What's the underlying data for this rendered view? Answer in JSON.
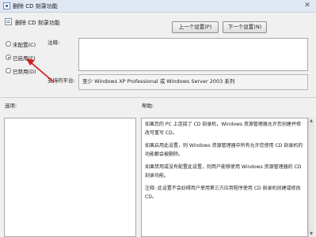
{
  "window": {
    "title": "删除 CD 刻录功能",
    "close_glyph": "✕"
  },
  "header": {
    "setting_name": "删除 CD 刻录功能"
  },
  "navigation": {
    "prev_label": "上一个设置(P)",
    "next_label": "下一个设置(N)"
  },
  "state_options": [
    {
      "label": "未配置",
      "key": "(C)",
      "selected": false
    },
    {
      "label": "已启用",
      "key": "(E)",
      "selected": true
    },
    {
      "label": "已禁用",
      "key": "(D)",
      "selected": false
    }
  ],
  "comment": {
    "label": "注释:",
    "value": ""
  },
  "platform": {
    "label": "支持的平台:",
    "value": "至少 Windows XP Professional 或 Windows Server 2003 系列"
  },
  "panels": {
    "options_label": "选项:",
    "help_label": "帮助:"
  },
  "help_text": [
    "如果您的 PC 上连接了 CD 刻录机，Windows 资源管理器允许您创建并修改可重写 CD。",
    "如果启用此设置，则 Windows 资源管理器中所有允许您使用 CD 刻录机的功能都会被删除。",
    "如果禁用或没有配置此设置，则用户能够使用 Windows 资源管理器的 CD 刻录功能。",
    "注释: 此设置不会妨碍用户使用第三方应用程序使用 CD 刻录机创建或修改 CD。"
  ],
  "colors": {
    "annotation_arrow": "#d0221c",
    "radio_selected": "#2a5ea8"
  }
}
